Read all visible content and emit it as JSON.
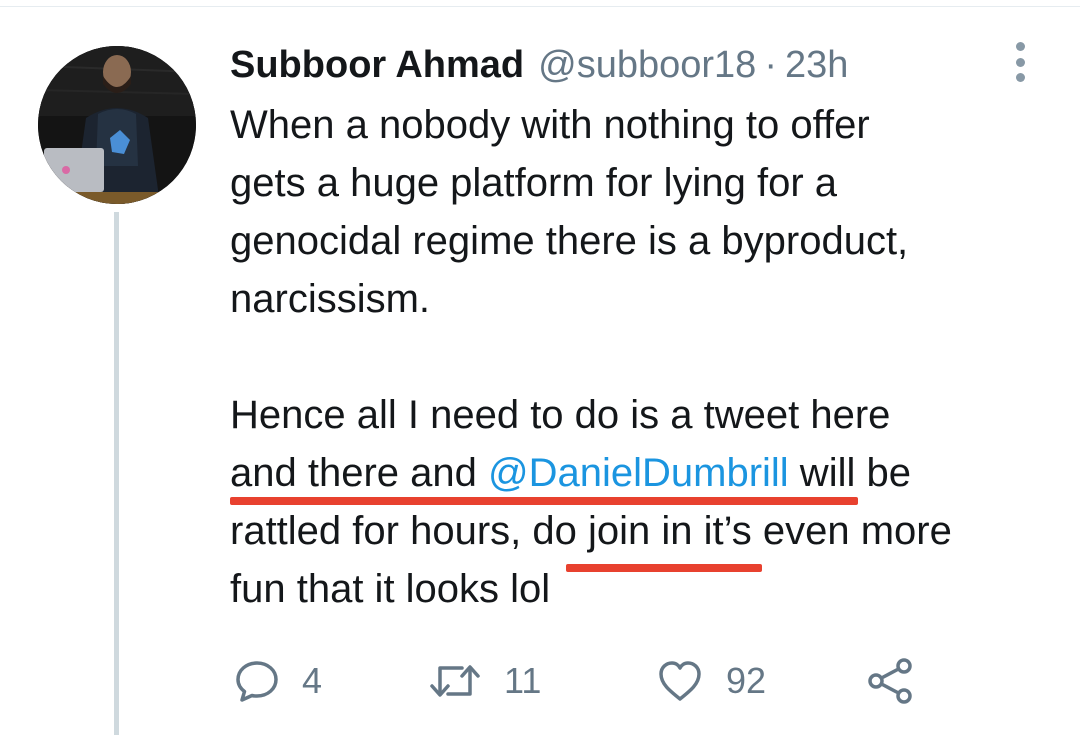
{
  "tweet": {
    "author_name": "Subboor Ahmad",
    "author_handle": "@subboor18",
    "separator": "·",
    "timestamp": "23h",
    "lines": [
      {
        "segments": [
          {
            "text": "When a nobody with nothing to offer"
          }
        ]
      },
      {
        "segments": [
          {
            "text": "gets a huge platform for lying for a"
          }
        ]
      },
      {
        "segments": [
          {
            "text": "genocidal regime there is a byproduct,"
          }
        ]
      },
      {
        "segments": [
          {
            "text": "narcissism."
          }
        ]
      },
      {
        "segments": []
      },
      {
        "segments": [
          {
            "text": "Hence all I need to do is a tweet here"
          }
        ]
      },
      {
        "segments": [
          {
            "text": "and there and "
          },
          {
            "text": "@DanielDumbrill",
            "mention": true
          },
          {
            "text": " will be"
          }
        ]
      },
      {
        "segments": [
          {
            "text": "rattled for hours, do join in it’s even more"
          }
        ]
      },
      {
        "segments": [
          {
            "text": "fun that it looks lol"
          }
        ]
      }
    ]
  },
  "actions": {
    "reply_count": "4",
    "retweet_count": "11",
    "like_count": "92"
  },
  "icons": {
    "reply": "speech-bubble-icon",
    "retweet": "retweet-arrows-icon",
    "like": "heart-outline-icon",
    "share": "share-nodes-icon",
    "more": "vertical-ellipsis-icon"
  },
  "colors": {
    "mention": "#1b95e0",
    "underline": "#e8412f",
    "muted": "#657786"
  }
}
